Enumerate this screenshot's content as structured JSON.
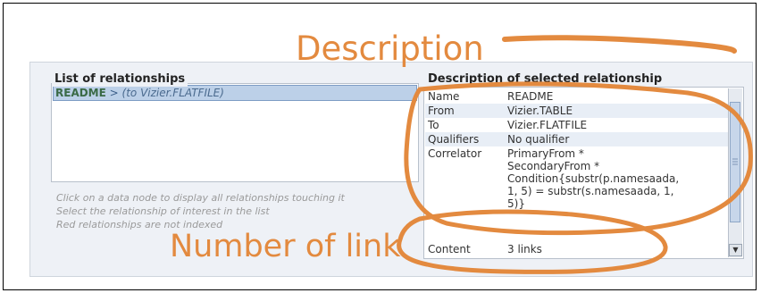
{
  "relationships": {
    "legend": "List of relationships",
    "items": [
      {
        "name": "README",
        "arrow": ">",
        "target": "(to Vizier.FLATFILE)"
      }
    ]
  },
  "hints": [
    "Click on a data node to display all relationships touching it",
    "Select the relationship of interest in the list",
    "Red relationships are not indexed"
  ],
  "description": {
    "legend": "Description of selected relationship",
    "rows": [
      {
        "key": "Name",
        "value": "README"
      },
      {
        "key": "From",
        "value": "Vizier.TABLE"
      },
      {
        "key": "To",
        "value": "Vizier.FLATFILE"
      },
      {
        "key": "Qualifiers",
        "value": "No qualifier"
      },
      {
        "key": "Correlator",
        "value": [
          "PrimaryFrom *",
          "SecondaryFrom *",
          "Condition{substr(p.namesaada,",
          "1, 5) = substr(s.namesaada, 1,",
          "5)}"
        ]
      },
      {
        "key": "Content",
        "value": "3 links"
      }
    ]
  },
  "annotations": {
    "description": "Description",
    "number_of_link": "Number of link",
    "color": "#e38a3f"
  }
}
